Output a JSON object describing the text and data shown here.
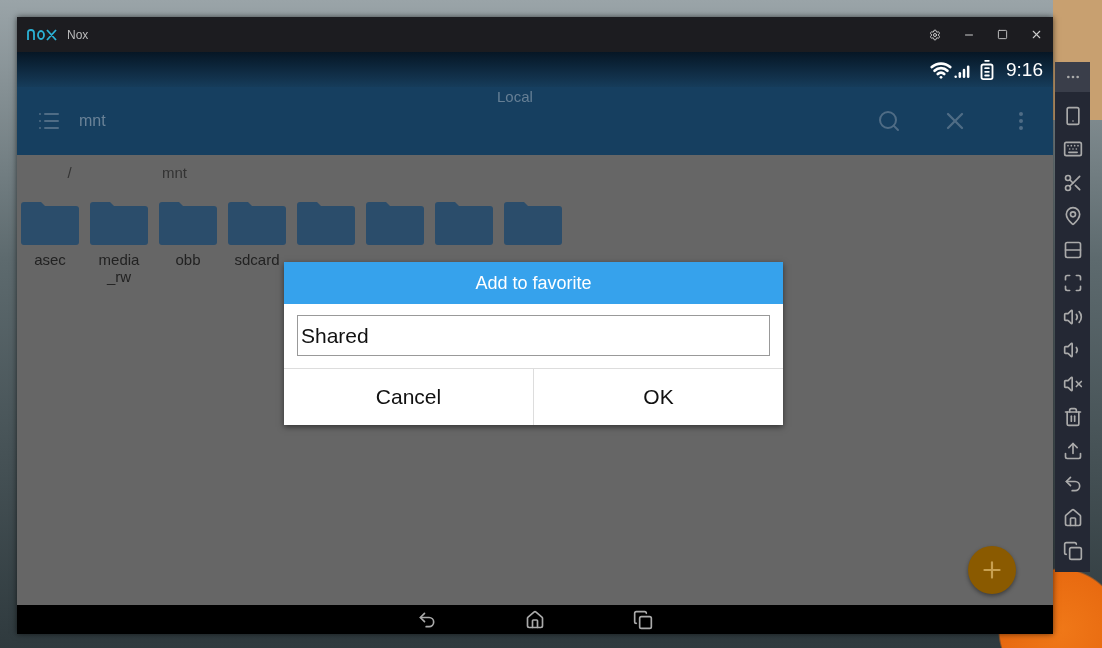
{
  "window": {
    "title": "Nox"
  },
  "status_bar": {
    "time": "9:16"
  },
  "app_bar": {
    "tab": "Local",
    "title": "mnt"
  },
  "breadcrumbs": [
    "/",
    "mnt"
  ],
  "folders": [
    {
      "kind": "labeled",
      "name": "asec"
    },
    {
      "kind": "labeled",
      "name": "media_rw"
    },
    {
      "kind": "labeled",
      "name": "obb"
    },
    {
      "kind": "labeled",
      "name": "sdcard"
    },
    {
      "kind": "covered"
    },
    {
      "kind": "covered"
    },
    {
      "kind": "covered"
    },
    {
      "kind": "covered"
    }
  ],
  "dialog": {
    "title": "Add to favorite",
    "value": "Shared",
    "buttons": [
      "Cancel",
      "OK"
    ]
  }
}
